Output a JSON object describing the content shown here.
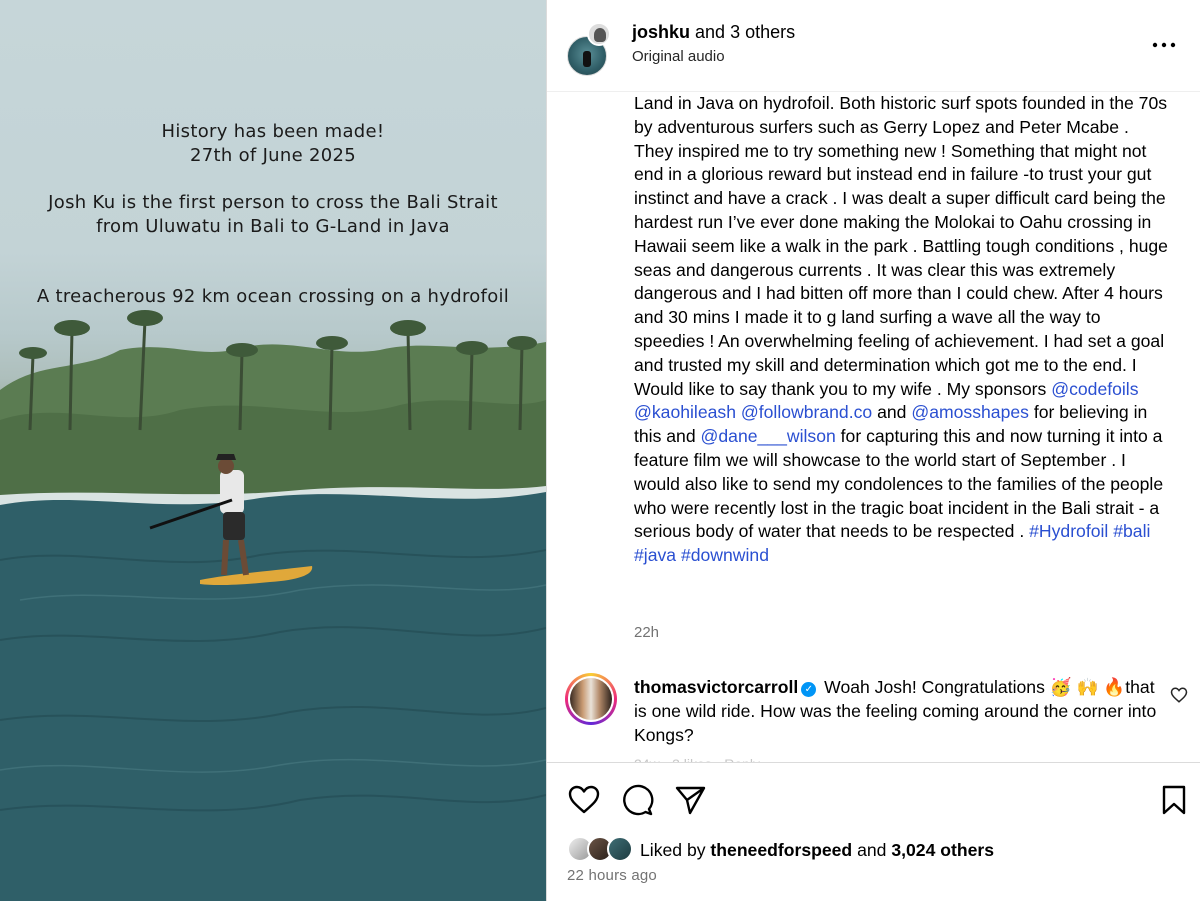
{
  "media": {
    "overlay_lines_1": [
      "History has been made!",
      "27th of June 2025"
    ],
    "overlay_lines_2": [
      "Josh Ku is the first person to cross the Bali Strait",
      "from Uluwatu in Bali to G-Land in Java"
    ],
    "overlay_line_3": "A treacherous 92 km ocean crossing on a hydrofoil"
  },
  "header": {
    "username": "joshku",
    "coauthors": "and 3 others",
    "audio": "Original audio",
    "more_icon": "more-horizontal-icon"
  },
  "caption": {
    "segments": [
      {
        "t": "Land in Java on hydrofoil. Both historic surf spots founded in the 70s by adventurous surfers such as Gerry Lopez and Peter Mcabe . They inspired me to try something new ! Something that might not end in a glorious reward but instead end in failure -to trust your gut instinct and have a crack . I was dealt a super difficult card being the hardest run I’ve ever done making the Molokai to Oahu crossing in Hawaii seem like a walk in the park . Battling tough conditions , huge seas and dangerous currents . It was clear this was extremely dangerous and I had bitten off more than I could chew. After 4 hours and 30 mins I made it to g land surfing a wave all the way to speedies ! An overwhelming feeling of achievement. I had set a goal and trusted my skill and determination which got me to the end. I Would like to say thank you to my wife . My sponsors "
      },
      {
        "t": "@codefoils",
        "link": true
      },
      {
        "t": " "
      },
      {
        "t": "@kaohileash",
        "link": true
      },
      {
        "t": " "
      },
      {
        "t": "@followbrand.co",
        "link": true
      },
      {
        "t": " and "
      },
      {
        "t": "@amosshapes",
        "link": true
      },
      {
        "t": " for believing in this and "
      },
      {
        "t": "@dane___wilson",
        "link": true
      },
      {
        "t": " for capturing this and now turning it into a feature film we will showcase to the world start of September . I would also like to send my condolences to the families of the people who were recently lost in the tragic boat incident in the Bali strait - a serious body of water that needs to be respected . "
      },
      {
        "t": "#Hydrofoil",
        "link": true
      },
      {
        "t": " "
      },
      {
        "t": "#bali",
        "link": true
      },
      {
        "t": " "
      },
      {
        "t": "#java",
        "link": true
      },
      {
        "t": " "
      },
      {
        "t": "#downwind",
        "link": true
      }
    ],
    "time": "22h"
  },
  "comment": {
    "username": "thomasvictorcarroll",
    "verified_icon": "verified-badge-icon",
    "text": "Woah Josh! Congratulations 🥳 🙌 🔥that is one wild ride. How was the feeling coming around the corner into Kongs?",
    "like_icon": "heart-icon"
  },
  "actions": {
    "like_icon": "heart-icon",
    "comment_icon": "comment-icon",
    "share_icon": "send-icon",
    "save_icon": "bookmark-icon",
    "liked_prefix": "Liked by",
    "liked_user": "theneedforspeed",
    "liked_and": "and",
    "liked_count": "3,024 others",
    "post_time": "22 hours ago"
  },
  "colors": {
    "link": "#2a4fd1",
    "verified": "#0095f6",
    "secondary_text": "#737373"
  }
}
